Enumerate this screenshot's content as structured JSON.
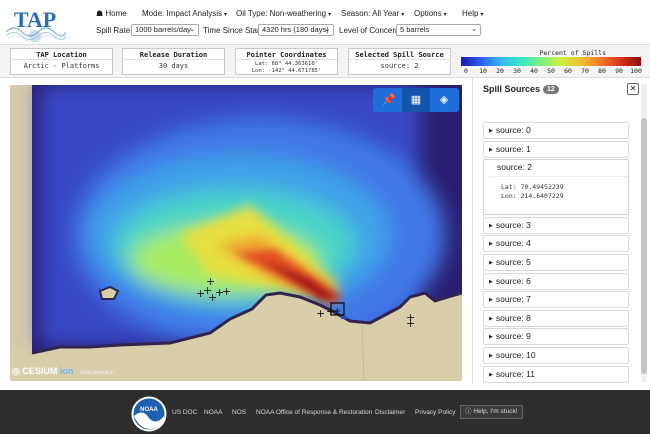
{
  "header": {
    "nav": {
      "home": "Home",
      "mode": "Mode: Impact Analysis",
      "oil_type": "Oil Type: Non-weathering",
      "season": "Season: All Year",
      "options": "Options",
      "help": "Help"
    },
    "spill_rate": {
      "label": "Spill Rate:",
      "value": "1000 barrels/day"
    },
    "time_since_start": {
      "label": "Time Since Start:",
      "value": "4320 hrs (180 days)"
    },
    "level_of_concern": {
      "label": "Level of Concern:",
      "value": "5 barrels"
    }
  },
  "info": {
    "tap_location": {
      "title": "TAP Location",
      "value": "Arctic - Platforms"
    },
    "release_duration": {
      "title": "Release Duration",
      "value": "30 days"
    },
    "pointer": {
      "title": "Pointer Coordinates",
      "lat": "Lat: 68° 44.363610'",
      "lon": "Lon: -142° 44.671785'"
    },
    "selected_source": {
      "title": "Selected Spill Source",
      "value": "source: 2"
    }
  },
  "colorbar": {
    "title": "Percent of Spills",
    "ticks": [
      "0",
      "10",
      "20",
      "30",
      "40",
      "50",
      "60",
      "70",
      "80",
      "90",
      "100"
    ]
  },
  "map": {
    "brand": "CESIUM",
    "brand_suffix": "ion",
    "attribution": "Data attribution",
    "toolbar_icons": [
      "pin-icon",
      "grid-icon",
      "layers-icon"
    ]
  },
  "sidebar": {
    "title": "Spill Sources",
    "count": "12",
    "sources": [
      {
        "label": "source: 0"
      },
      {
        "label": "source: 1"
      },
      {
        "label": "source: 2",
        "lat": "Lat: 70.49452239",
        "lon": "Lon: 214.6407229"
      },
      {
        "label": "source: 3"
      },
      {
        "label": "source: 4"
      },
      {
        "label": "source: 5"
      },
      {
        "label": "source: 6"
      },
      {
        "label": "source: 7"
      },
      {
        "label": "source: 8"
      },
      {
        "label": "source: 9"
      },
      {
        "label": "source: 10"
      },
      {
        "label": "source: 11"
      }
    ]
  },
  "footer": {
    "links": [
      "US DOC",
      "NOAA",
      "NOS",
      "NOAA Office of Response & Restoration",
      "Disclaimer",
      "Privacy Policy"
    ],
    "help": "Help, I'm stuck!",
    "logo_text": "NOAA"
  },
  "logo": {
    "text": "TAP"
  }
}
